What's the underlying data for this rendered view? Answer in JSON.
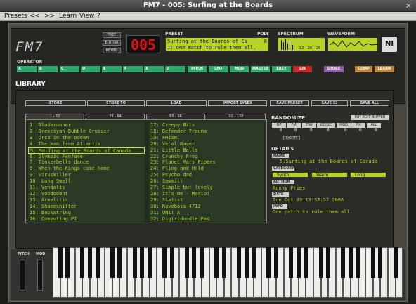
{
  "window": {
    "title": "FM7 - 005: Surfing at the Boards",
    "close_glyph": "✕"
  },
  "menubar": [
    {
      "label": "Presets"
    },
    {
      "label": "<<"
    },
    {
      "label": ">>"
    },
    {
      "label": "Learn"
    },
    {
      "label": "View"
    },
    {
      "label": "?"
    }
  ],
  "header": {
    "logo": "FM7",
    "mode_buttons": [
      "PREF",
      "EDITOR",
      "KEYBD"
    ],
    "preset_number": "005",
    "preset_label": "PRESET",
    "poly_label": "POLY",
    "preset_line1": "Surfing at the Boards of Ca",
    "preset_line2": "1: One match to rule them all.",
    "poly_value": "8",
    "spectrum_label": "SPECTRUM",
    "spectrum_ticks": [
      "12",
      "20",
      "26"
    ],
    "waveform_label": "WAVEFORM",
    "ni_logo": "NI"
  },
  "operator": {
    "label": "OPERATOR",
    "ops": [
      "A",
      "B",
      "C",
      "D",
      "E",
      "F",
      "X",
      "Z"
    ],
    "functions": [
      {
        "label": "PITCH",
        "color": "#2fa86a"
      },
      {
        "label": "LFO",
        "color": "#2fa86a"
      },
      {
        "label": "MOD",
        "color": "#2fa86a"
      },
      {
        "label": "MASTER",
        "color": "#2fa86a"
      },
      {
        "label": "EASY",
        "color": "#2fa86a"
      },
      {
        "label": "LIB",
        "color": "#c0282a"
      }
    ],
    "store": {
      "label": "STORE",
      "color": "#8e5fa8"
    },
    "comp": {
      "label": "COMP",
      "color": "#c3873a"
    },
    "learn": {
      "label": "LEARN",
      "color": "#c3873a"
    }
  },
  "library": {
    "title": "LIBRARY",
    "top_buttons": [
      "STORE",
      "STORE TO",
      "LOAD",
      "IMPORT SYSEX",
      "SAVE PRESET",
      "SAVE 32",
      "SAVE ALL"
    ],
    "tabs": [
      "1 - 32",
      "33 - 64",
      "65 - 96",
      "97 - 128"
    ],
    "presets_col1": [
      "1: Bladerunner",
      "2: Drexciyan Bubble Cruiser",
      "3: Orca in the ocean",
      "4: The man from Atlantis",
      "5: Surfing at the Boards of Canada",
      "6: Olympic Fanfare",
      "7: Tinkerbells dance",
      "8: When the Kings come home",
      "9: Viruskiller",
      "10: Long Swell",
      "11: Vendalis",
      "12: Voodooant",
      "13: Armelitis",
      "14: Shameshifter",
      "15: Backstring",
      "16: Computing PI"
    ],
    "presets_col2": [
      "17: Creepy Bits",
      "18: Defender Trauma",
      "19: FMism.",
      "20: Ve'ol Raver",
      "21: Little Bells",
      "22: Crunchy Frog",
      "23: Planet Mars Pipers",
      "24: Pling and Hold",
      "25: Psycho dad",
      "26: Sawmill",
      "27: Simple but lovely",
      "28: It's me - Mario!",
      "29: Statist",
      "30: Ravebass 4712",
      "31: UNIT A",
      "32: Digiridoodle Pad"
    ],
    "selected_index": 4
  },
  "randomize": {
    "label": "RANDOMIZE",
    "init_button": "INIT EDIT BUFFER",
    "columns": [
      "OP",
      "FM",
      "ENV",
      "KEYSC",
      "MOD",
      "FX",
      "ALL"
    ],
    "values": [
      "0",
      "0",
      "0",
      "0",
      "0",
      "0",
      "0"
    ],
    "do_it": "DO IT!"
  },
  "details": {
    "label": "DETAILS",
    "name_label": "NAME",
    "name_value": "5:Surfing at the Boards of Canada",
    "category_label": "CATEGORY",
    "categories": [
      "Synth",
      "Warm",
      "Long"
    ],
    "author_label": "AUTHOR",
    "author_value": "Ronny Pries",
    "date_label": "DATE",
    "date_value": "Tue Oct 03 13:32:57 2006",
    "info_label": "INFO",
    "info_value": "One patch to rule them all."
  },
  "keyboard": {
    "pitch_label": "PITCH",
    "mod_label": "MOD"
  }
}
